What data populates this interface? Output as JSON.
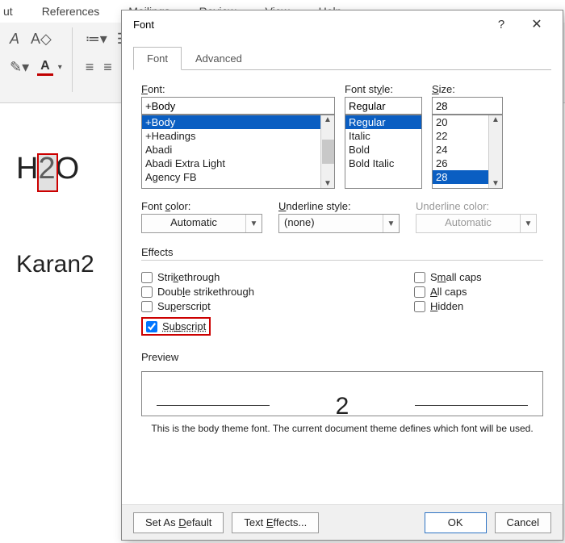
{
  "ribbon": {
    "tabs": [
      "ut",
      "References",
      "Mailings",
      "Review",
      "View",
      "Help"
    ]
  },
  "doc": {
    "line1_pre": "H",
    "line1_sel": "2",
    "line1_post": "O",
    "line2": "Karan2"
  },
  "dialog": {
    "title": "Font",
    "help": "?",
    "close": "✕",
    "tabs": {
      "font": "Font",
      "advanced": "Advanced"
    },
    "font": {
      "label": "Font:",
      "value": "+Body",
      "items": [
        "+Body",
        "+Headings",
        "Abadi",
        "Abadi Extra Light",
        "Agency FB"
      ],
      "selected": "+Body"
    },
    "style": {
      "label": "Font style:",
      "value": "Regular",
      "items": [
        "Regular",
        "Italic",
        "Bold",
        "Bold Italic"
      ],
      "selected": "Regular"
    },
    "size": {
      "label": "Size:",
      "value": "28",
      "items": [
        "20",
        "22",
        "24",
        "26",
        "28"
      ],
      "selected": "28"
    },
    "fontcolor": {
      "label": "Font color:",
      "value": "Automatic"
    },
    "ulstyle": {
      "label": "Underline style:",
      "value": "(none)"
    },
    "ulcolor": {
      "label": "Underline color:",
      "value": "Automatic"
    },
    "effects": {
      "label": "Effects",
      "strikethrough": "Strikethrough",
      "dstrike": "Double strikethrough",
      "superscript": "Superscript",
      "subscript": "Subscript",
      "smallcaps": "Small caps",
      "allcaps": "All caps",
      "hidden": "Hidden"
    },
    "preview": {
      "label": "Preview",
      "text": "2",
      "note": "This is the body theme font. The current document theme defines which font will be used."
    },
    "buttons": {
      "setdefault": "Set As Default",
      "texteffects": "Text Effects...",
      "ok": "OK",
      "cancel": "Cancel"
    }
  }
}
